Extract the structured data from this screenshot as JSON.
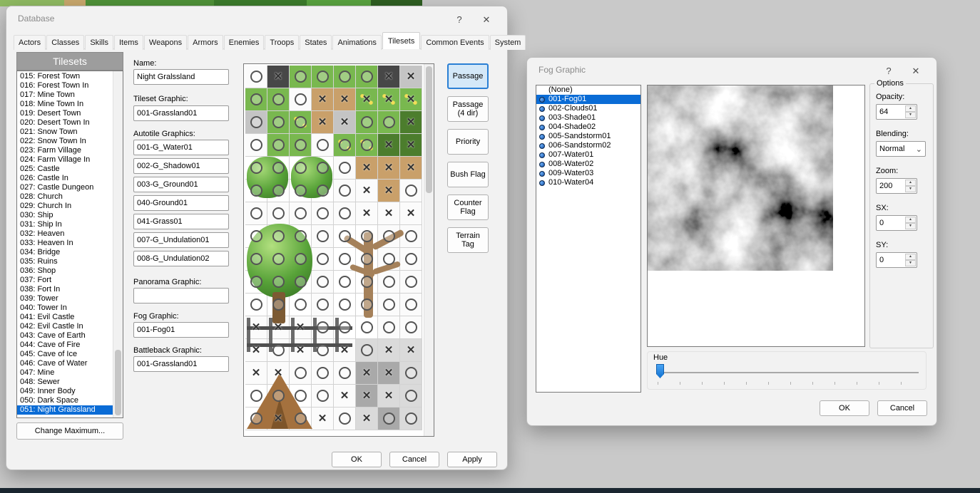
{
  "icons": {
    "help_glyph": "?",
    "close_glyph": "✕",
    "chevron": "⌄",
    "spinner_up": "▲",
    "spinner_down": "▼",
    "block_glyph": "✕"
  },
  "colors": {
    "selection_blue": "#0a6cd6",
    "active_button_blue": "#2a7fd4",
    "hue_thumb_blue": "#1272d0"
  },
  "database": {
    "title": "Database",
    "tabs": [
      "Actors",
      "Classes",
      "Skills",
      "Items",
      "Weapons",
      "Armors",
      "Enemies",
      "Troops",
      "States",
      "Animations",
      "Tilesets",
      "Common Events",
      "System"
    ],
    "active_tab": "Tilesets",
    "left_panel": {
      "header": "Tilesets",
      "selected_index": 36,
      "items": [
        "015: Forest Town",
        "016: Forest Town In",
        "017: Mine Town",
        "018: Mine Town In",
        "019: Desert Town",
        "020: Desert Town In",
        "021: Snow Town",
        "022: Snow Town In",
        "023: Farm Village",
        "024: Farm Village In",
        "025: Castle",
        "026: Castle In",
        "027: Castle Dungeon",
        "028: Church",
        "029: Church In",
        "030: Ship",
        "031: Ship In",
        "032: Heaven",
        "033: Heaven In",
        "034: Bridge",
        "035: Ruins",
        "036: Shop",
        "037: Fort",
        "038: Fort In",
        "039: Tower",
        "040: Tower In",
        "041: Evil Castle",
        "042: Evil Castle In",
        "043: Cave of Earth",
        "044: Cave of Fire",
        "045: Cave of Ice",
        "046: Cave of Water",
        "047: Mine",
        "048: Sewer",
        "049: Inner Body",
        "050: Dark Space",
        "051: Night Gralssland"
      ],
      "change_max_label": "Change Maximum..."
    },
    "form": {
      "name": {
        "label": "Name:",
        "value": "Night Gralssland"
      },
      "tileset_graphic": {
        "label": "Tileset Graphic:",
        "value": "001-Grassland01"
      },
      "autotile": {
        "label": "Autotile Graphics:",
        "values": [
          "001-G_Water01",
          "002-G_Shadow01",
          "003-G_Ground01",
          "040-Ground01",
          "041-Grass01",
          "007-G_Undulation01",
          "008-G_Undulation02"
        ]
      },
      "panorama": {
        "label": "Panorama Graphic:",
        "value": ""
      },
      "fog": {
        "label": "Fog Graphic:",
        "value": "001-Fog01"
      },
      "battleback": {
        "label": "Battleback Graphic:",
        "value": "001-Grassland01"
      }
    },
    "mode_buttons": [
      {
        "label": "Passage",
        "active": true
      },
      {
        "label": "Passage (4 dir)",
        "active": false
      },
      {
        "label": "Priority",
        "active": false
      },
      {
        "label": "Bush Flag",
        "active": false
      },
      {
        "label": "Counter Flag",
        "active": false
      },
      {
        "label": "Terrain Tag",
        "active": false
      }
    ],
    "tile_grid": {
      "rows": [
        "w:O d:X g:O g:O g:O g:O d:X G:X",
        "g:O g:O w:O t:X t:X f:X f:X f:X",
        "G:O g:O f:O t:X G:X g:O g:O b:X",
        "w:O g:O g:O w:O f:O f:O b:X b:X",
        "-:O -:O -:O -:O w:O t:X t:X t:X",
        "-:O -:O -:O -:O w:O w:X t:X w:O",
        "w:O w:O w:O w:O w:O w:X w:X w:X",
        "-:O -:O -:O w:O -:O -:O w:O w:O",
        "-:O -:O -:O w:O -:O -:O w:O w:O",
        "-:O -:O -:O w:O -:O -:O w:O w:O",
        "-:O -:O -:O w:O -:O -:O w:O w:O",
        "w:X w:X w:X w:O -:O -:O w:O w:O",
        "w:X w:O w:X w:O w:X C:O C:X C:X",
        "w:X w:X w:O w:O w:O c:X c:X C:O",
        "-:O -:O -:O w:O w:X c:X C:X C:O",
        "-:O -:X -:O w:X w:O C:X c:O C:O"
      ]
    },
    "footer_buttons": [
      "OK",
      "Cancel",
      "Apply"
    ]
  },
  "fog": {
    "title": "Fog Graphic",
    "selected_index": 1,
    "items": [
      {
        "label": "(None)",
        "has_icon": false
      },
      {
        "label": "001-Fog01",
        "has_icon": true
      },
      {
        "label": "002-Clouds01",
        "has_icon": true
      },
      {
        "label": "003-Shade01",
        "has_icon": true
      },
      {
        "label": "004-Shade02",
        "has_icon": true
      },
      {
        "label": "005-Sandstorm01",
        "has_icon": true
      },
      {
        "label": "006-Sandstorm02",
        "has_icon": true
      },
      {
        "label": "007-Water01",
        "has_icon": true
      },
      {
        "label": "008-Water02",
        "has_icon": true
      },
      {
        "label": "009-Water03",
        "has_icon": true
      },
      {
        "label": "010-Water04",
        "has_icon": true
      }
    ],
    "options": {
      "group_label": "Options",
      "fields": [
        {
          "label": "Opacity:",
          "value": "64",
          "control": "spinner"
        },
        {
          "label": "Blending:",
          "value": "Normal",
          "control": "dropdown"
        },
        {
          "label": "Zoom:",
          "value": "200",
          "control": "spinner"
        },
        {
          "label": "SX:",
          "value": "0",
          "control": "spinner"
        },
        {
          "label": "SY:",
          "value": "0",
          "control": "spinner"
        }
      ]
    },
    "hue_label": "Hue",
    "hue_value_position": "0",
    "buttons": [
      "OK",
      "Cancel"
    ]
  }
}
